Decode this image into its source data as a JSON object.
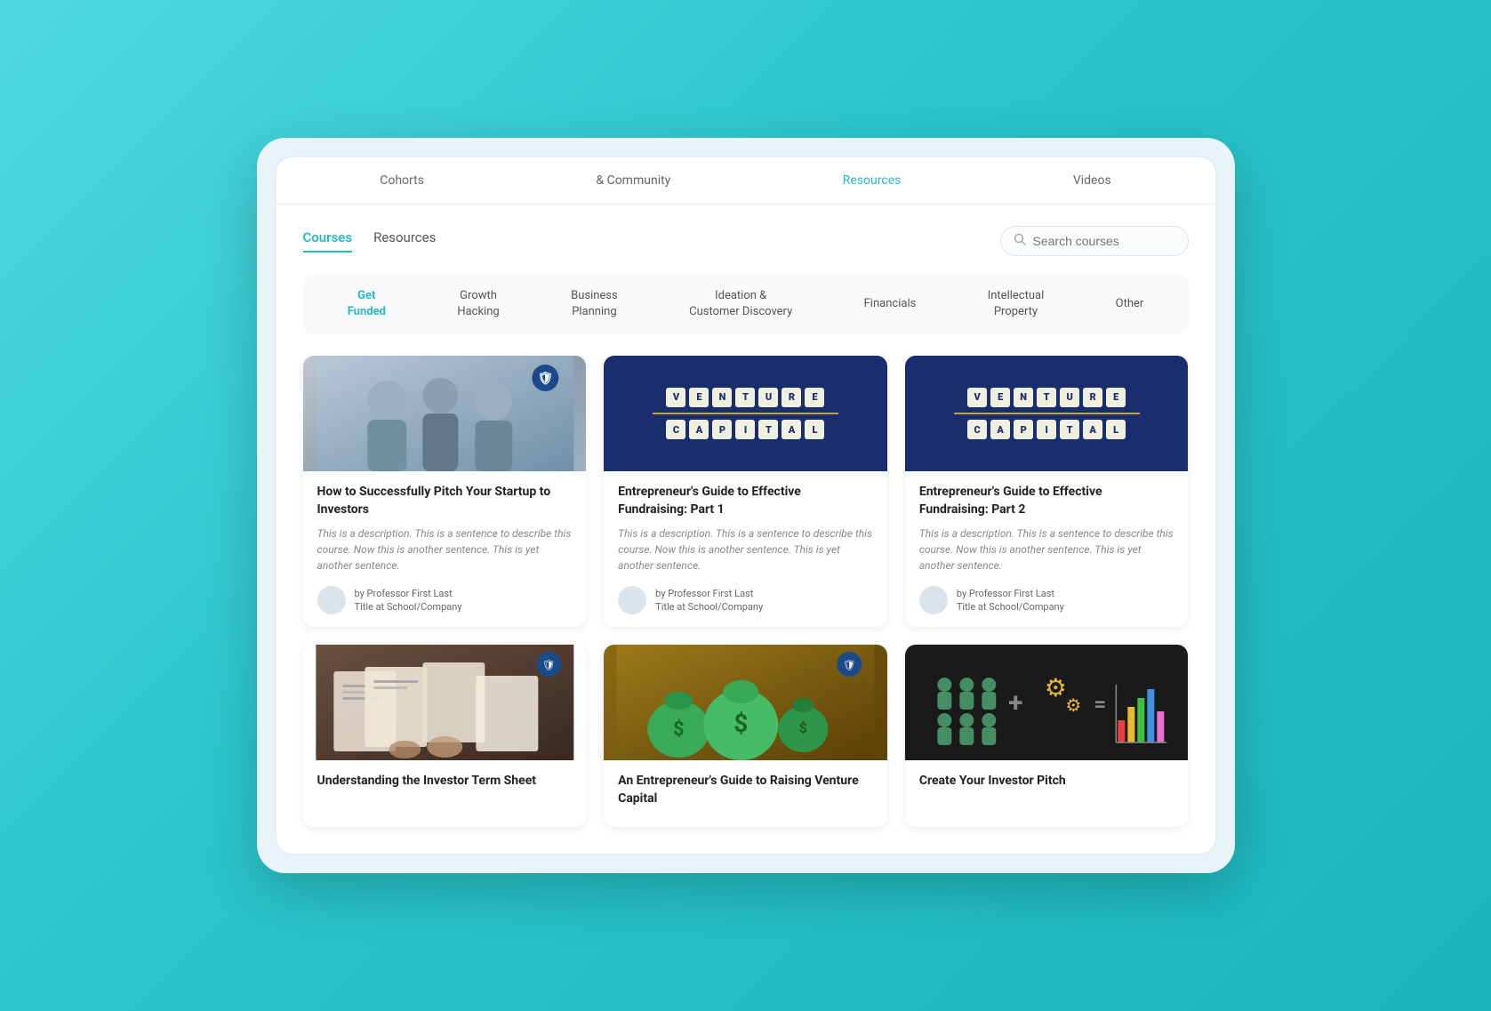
{
  "topNav": {
    "items": [
      {
        "label": "Cohorts",
        "active": false
      },
      {
        "label": "& Community",
        "active": false
      },
      {
        "label": "Resources",
        "active": true
      },
      {
        "label": "Videos",
        "active": false
      }
    ]
  },
  "tabs": {
    "items": [
      {
        "label": "Courses",
        "active": true
      },
      {
        "label": "Resources",
        "active": false
      }
    ]
  },
  "search": {
    "placeholder": "Search courses"
  },
  "categories": [
    {
      "label": "Get\nFunded",
      "active": true
    },
    {
      "label": "Growth\nHacking",
      "active": false
    },
    {
      "label": "Business\nPlanning",
      "active": false
    },
    {
      "label": "Ideation &\nCustomer Discovery",
      "active": false
    },
    {
      "label": "Financials",
      "active": false
    },
    {
      "label": "Intellectual\nProperty",
      "active": false
    },
    {
      "label": "Other",
      "active": false
    }
  ],
  "courses": [
    {
      "id": 1,
      "title": "How to Successfully Pitch Your Startup to Investors",
      "description": "This is a description. This is a sentence to describe this course. Now this is another sentence. This is yet another sentence.",
      "author": "by Professor First Last",
      "authorTitle": "Title at School/Company",
      "imageType": "people"
    },
    {
      "id": 2,
      "title": "Entrepreneur's Guide to Effective Fundraising: Part 1",
      "description": "This is a description. This is a sentence to describe this course. Now this is another sentence. This is yet another sentence.",
      "author": "by Professor First Last",
      "authorTitle": "Title at School/Company",
      "imageType": "vc1"
    },
    {
      "id": 3,
      "title": "Entrepreneur's Guide to Effective Fundraising: Part 2",
      "description": "This is a description. This is a sentence to describe this course. Now this is another sentence. This is yet another sentence.",
      "author": "by Professor First Last",
      "authorTitle": "Title at School/Company",
      "imageType": "vc2"
    },
    {
      "id": 4,
      "title": "Understanding the Investor Term Sheet",
      "description": "",
      "author": "",
      "authorTitle": "",
      "imageType": "termsheet"
    },
    {
      "id": 5,
      "title": "An Entrepreneur's Guide to Raising Venture Capital",
      "description": "",
      "author": "",
      "authorTitle": "",
      "imageType": "raisevc"
    },
    {
      "id": 6,
      "title": "Create Your Investor Pitch",
      "description": "",
      "author": "",
      "authorTitle": "",
      "imageType": "createpitch"
    }
  ],
  "vcLetters1": [
    "V",
    "E",
    "N",
    "T",
    "U",
    "R",
    "E",
    "C",
    "A",
    "P",
    "I",
    "T",
    "A",
    "L"
  ],
  "colors": {
    "accent": "#29b8c4",
    "text": "#222",
    "muted": "#888",
    "border": "#e0eaf2"
  }
}
